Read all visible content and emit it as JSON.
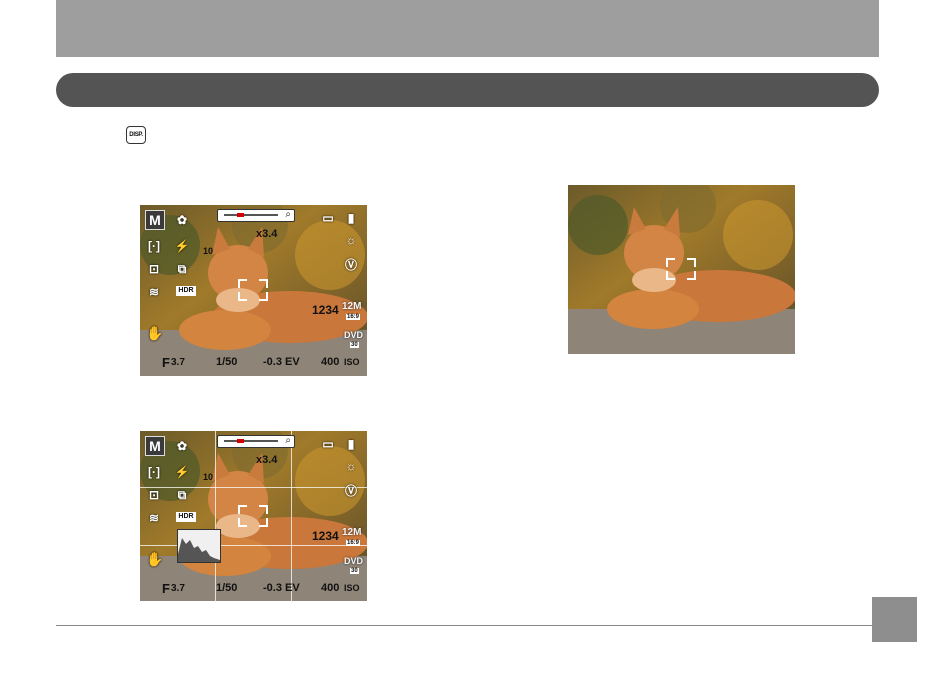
{
  "header": {
    "section_title": ""
  },
  "disp_button": {
    "label": "DISP.",
    "icon": "disp-button-icon"
  },
  "camera_screen": {
    "mode": "M",
    "zoom": "x3.4",
    "timer": "10",
    "shots_remaining": "1234",
    "image_size": "12M",
    "aspect": "16:9",
    "video_quality": "DVD",
    "fps": "30",
    "aperture_prefix": "F",
    "aperture_value": "3.7",
    "shutter": "1/50",
    "ev": "-0.3 EV",
    "iso_value": "400",
    "iso_unit": "ISO",
    "hdr": "HDR"
  },
  "page_number_box": {
    "color": "#8e8e8e"
  }
}
